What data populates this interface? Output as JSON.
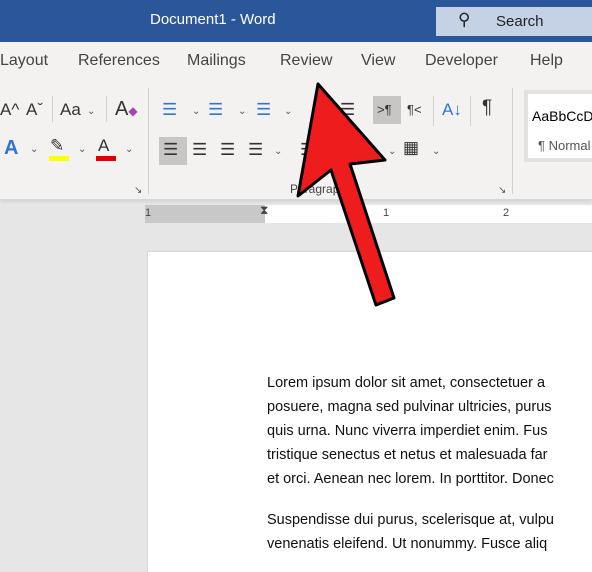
{
  "titlebar": {
    "title": "Document1  -  Word",
    "search_label": "Search",
    "search_icon": "search-icon"
  },
  "tabs": [
    "Layout",
    "References",
    "Mailings",
    "Review",
    "View",
    "Developer",
    "Help"
  ],
  "ribbon": {
    "font": {
      "grow": "A^",
      "shrink": "Aˇ",
      "change_case": "Aa",
      "text_effects": "A",
      "font_color": "A",
      "highlight_color": "#ffff00",
      "font_color_value": "#e00000"
    },
    "paragraph": {
      "group_label": "Paragraph",
      "ltr": ">¶",
      "rtl": "¶<",
      "sort": "A↓",
      "show_marks": "¶"
    },
    "styles": {
      "preview": "AaBbCcD",
      "name": "¶ Normal"
    }
  },
  "ruler": {
    "labels": [
      "1",
      "1",
      "2"
    ]
  },
  "document": {
    "paragraphs": [
      [
        "Lorem ipsum dolor sit amet, consectetuer a",
        "posuere, magna sed pulvinar ultricies, purus",
        "quis urna. Nunc viverra imperdiet enim. Fus",
        "tristique senectus et netus et malesuada far",
        "et orci. Aenean nec lorem. In porttitor. Donec"
      ],
      [
        "Suspendisse dui purus, scelerisque at, vulpu",
        "venenatis eleifend. Ut nonummy. Fusce aliq"
      ]
    ]
  },
  "annotation": {
    "arrow_color": "#ee1c1c",
    "points_to": "Review"
  }
}
